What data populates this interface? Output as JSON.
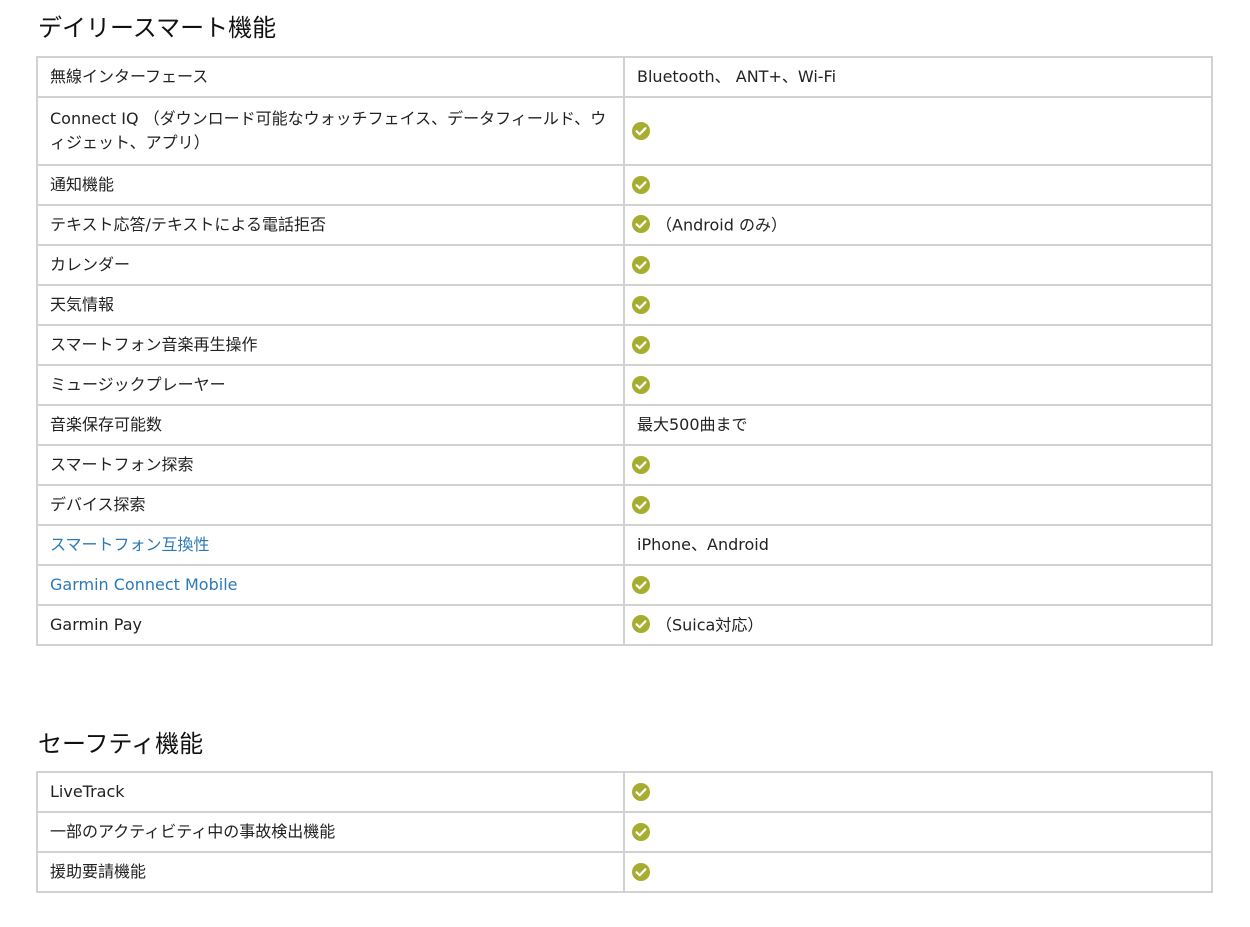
{
  "colors": {
    "check_fill": "#a7ad2e",
    "link": "#2a7ab8",
    "border": "#d2d2d2"
  },
  "daily_smart": {
    "title": "デイリースマート機能",
    "rows": [
      {
        "label": "無線インターフェース",
        "value": "Bluetooth、 ANT+、Wi-Fi"
      },
      {
        "label": "Connect IQ （ダウンロード可能なウォッチフェイス、データフィールド、ウィジェット、アプリ）",
        "check": true
      },
      {
        "label": "通知機能",
        "check": true
      },
      {
        "label": "テキスト応答/テキストによる電話拒否",
        "check": true,
        "note": "（Android のみ）"
      },
      {
        "label": "カレンダー",
        "check": true
      },
      {
        "label": "天気情報",
        "check": true
      },
      {
        "label": "スマートフォン音楽再生操作",
        "check": true
      },
      {
        "label": "ミュージックプレーヤー",
        "check": true
      },
      {
        "label": "音楽保存可能数",
        "value": "最大500曲まで"
      },
      {
        "label": "スマートフォン探索",
        "check": true
      },
      {
        "label": "デバイス探索",
        "check": true
      },
      {
        "label": "スマートフォン互換性",
        "value": "iPhone、Android",
        "link": true
      },
      {
        "label": "Garmin Connect Mobile",
        "check": true,
        "link": true
      },
      {
        "label": "Garmin Pay",
        "check": true,
        "note": "（Suica対応）"
      }
    ]
  },
  "safety": {
    "title": "セーフティ機能",
    "rows": [
      {
        "label": "LiveTrack",
        "check": true
      },
      {
        "label": "一部のアクティビティ中の事故検出機能",
        "check": true
      },
      {
        "label": "援助要請機能",
        "check": true
      }
    ]
  },
  "icons": {
    "check": "check-circle-icon"
  }
}
